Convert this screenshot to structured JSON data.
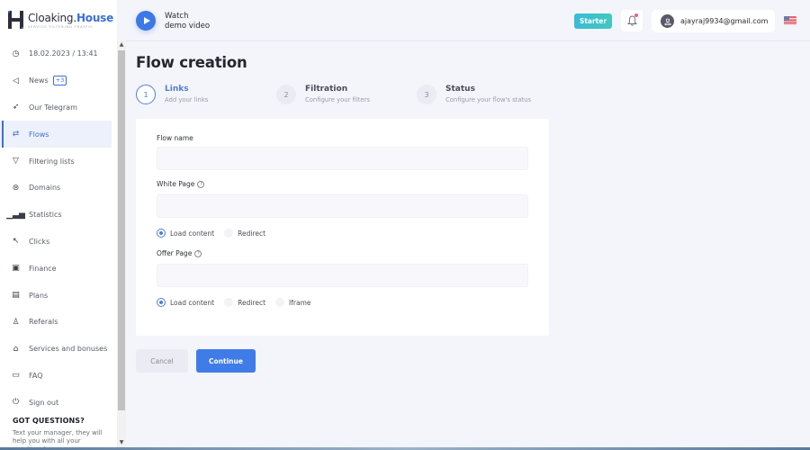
{
  "brand": {
    "name_part1": "Cloaking.",
    "name_part2": "House",
    "tagline": "SERVICE FILTERING TRAFFIC"
  },
  "sidebar": {
    "datetime": "18.02.2023 / 13:41",
    "items": [
      {
        "label": "News",
        "icon": "megaphone-icon",
        "badge": "+3"
      },
      {
        "label": "Our Telegram",
        "icon": "telegram-icon"
      },
      {
        "label": "Flows",
        "icon": "refresh-icon",
        "active": true
      },
      {
        "label": "Filtering lists",
        "icon": "filter-icon"
      },
      {
        "label": "Domains",
        "icon": "domain-icon"
      },
      {
        "label": "Statistics",
        "icon": "bar-chart-icon"
      },
      {
        "label": "Clicks",
        "icon": "cursor-click-icon"
      },
      {
        "label": "Finance",
        "icon": "wallet-icon"
      },
      {
        "label": "Plans",
        "icon": "card-icon"
      },
      {
        "label": "Referals",
        "icon": "user-icon"
      },
      {
        "label": "Services and bonuses",
        "icon": "gift-icon"
      },
      {
        "label": "FAQ",
        "icon": "chat-icon"
      },
      {
        "label": "Sign out",
        "icon": "power-icon"
      }
    ],
    "questions": {
      "title": "GOT QUESTIONS?",
      "text": "Text your manager, they will help you with all your questions!"
    }
  },
  "header": {
    "watch_line1": "Watch",
    "watch_line2": "demo video",
    "plan": "Starter",
    "email": "ajayraj9934@gmail.com",
    "language": "US"
  },
  "main": {
    "title": "Flow creation",
    "steps": [
      {
        "num": "1",
        "title": "Links",
        "subtitle": "Add your links",
        "active": true
      },
      {
        "num": "2",
        "title": "Filtration",
        "subtitle": "Configure your filters"
      },
      {
        "num": "3",
        "title": "Status",
        "subtitle": "Configure your flow's status"
      }
    ],
    "form": {
      "flow_name_label": "Flow name",
      "flow_name_value": "",
      "white_page_label": "White Page",
      "white_page_value": "",
      "white_page_options": [
        "Load content",
        "Redirect"
      ],
      "white_page_selected": "Load content",
      "offer_page_label": "Offer Page",
      "offer_page_value": "",
      "offer_page_options": [
        "Load content",
        "Redirect",
        "Iframe"
      ],
      "offer_page_selected": "Load content",
      "help_glyph": "?"
    },
    "cancel_label": "Cancel",
    "continue_label": "Continue"
  },
  "colors": {
    "accent": "#3f7ce8",
    "starter_badge": "#3bbbd6",
    "notification_dot": "#e8617a"
  }
}
